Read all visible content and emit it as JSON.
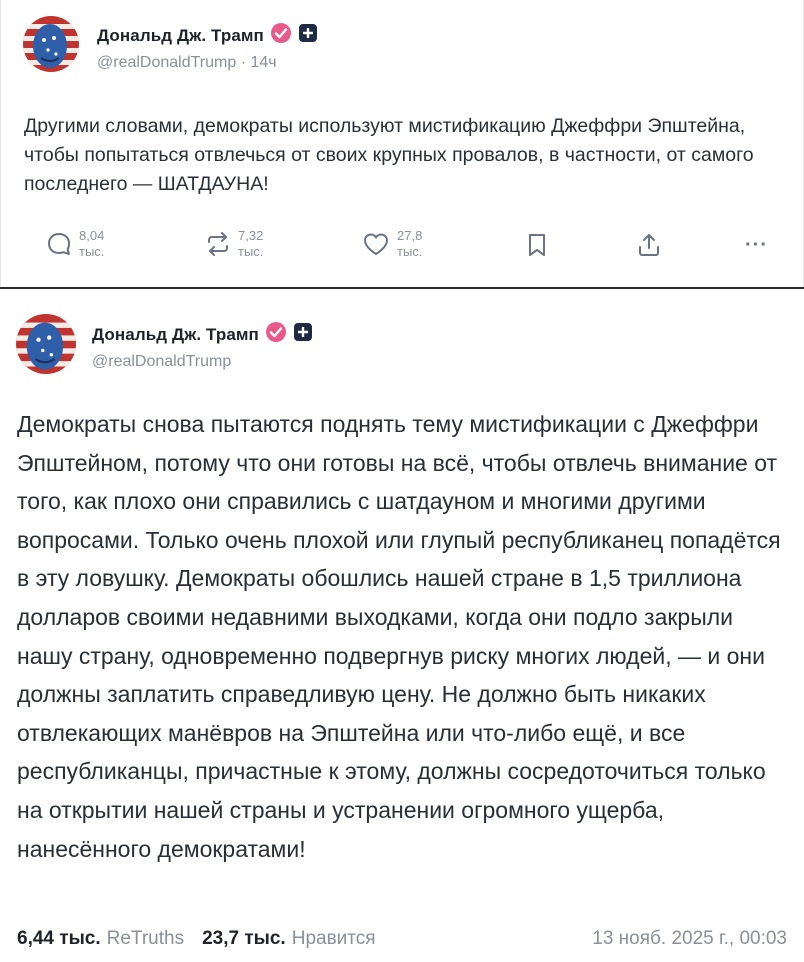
{
  "post1": {
    "author": "Дональд Дж. Трамп",
    "handle": "@realDonaldTrump",
    "sep": " · ",
    "time": "14ч",
    "text": "Другими словами, демократы используют мистификацию Джеффри Эпштейна, чтобы попытаться отвлечься от своих крупных провалов, в частности, от самого последнего — ШАТДАУНА!",
    "actions": {
      "replies": {
        "value": "8,04",
        "unit": "тыс."
      },
      "retruths": {
        "value": "7,32",
        "unit": "тыс."
      },
      "likes": {
        "value": "27,8",
        "unit": "тыс."
      },
      "more": "···"
    }
  },
  "post2": {
    "author": "Дональд Дж. Трамп",
    "handle": "@realDonaldTrump",
    "text": "Демократы снова пытаются поднять тему мистификации с Джеффри Эпштейном, потому что они готовы на всё, чтобы отвлечь внимание от того, как плохо они справились с шатдауном и многими другими вопросами. Только очень плохой или глупый республиканец попадётся в эту ловушку. Демократы обошлись нашей стране в 1,5 триллиона долларов своими недавними выходками, когда они подло закрыли нашу страну, одновременно подвергнув риску многих людей, — и они должны заплатить справедливую цену. Не должно быть никаких отвлекающих манёвров на Эпштейна или что-либо ещё, и все республиканцы, причастные к этому, должны сосредоточиться только на открытии нашей страны и устранении огромного ущерба, нанесённого демократами!",
    "footer": {
      "retruths_count": "6,44 тыс.",
      "retruths_label": "ReTruths",
      "likes_count": "23,7 тыс.",
      "likes_label": "Нравится",
      "datetime": "13 нояб. 2025 г., 00:03"
    }
  },
  "colors": {
    "verified": "#e85a8a",
    "muted": "#8a8f98",
    "text": "#2a2f36"
  },
  "icons": [
    "reply-icon",
    "retruth-icon",
    "like-icon",
    "bookmark-icon",
    "share-icon",
    "more-icon",
    "verified-badge-icon",
    "plus-badge-icon"
  ]
}
